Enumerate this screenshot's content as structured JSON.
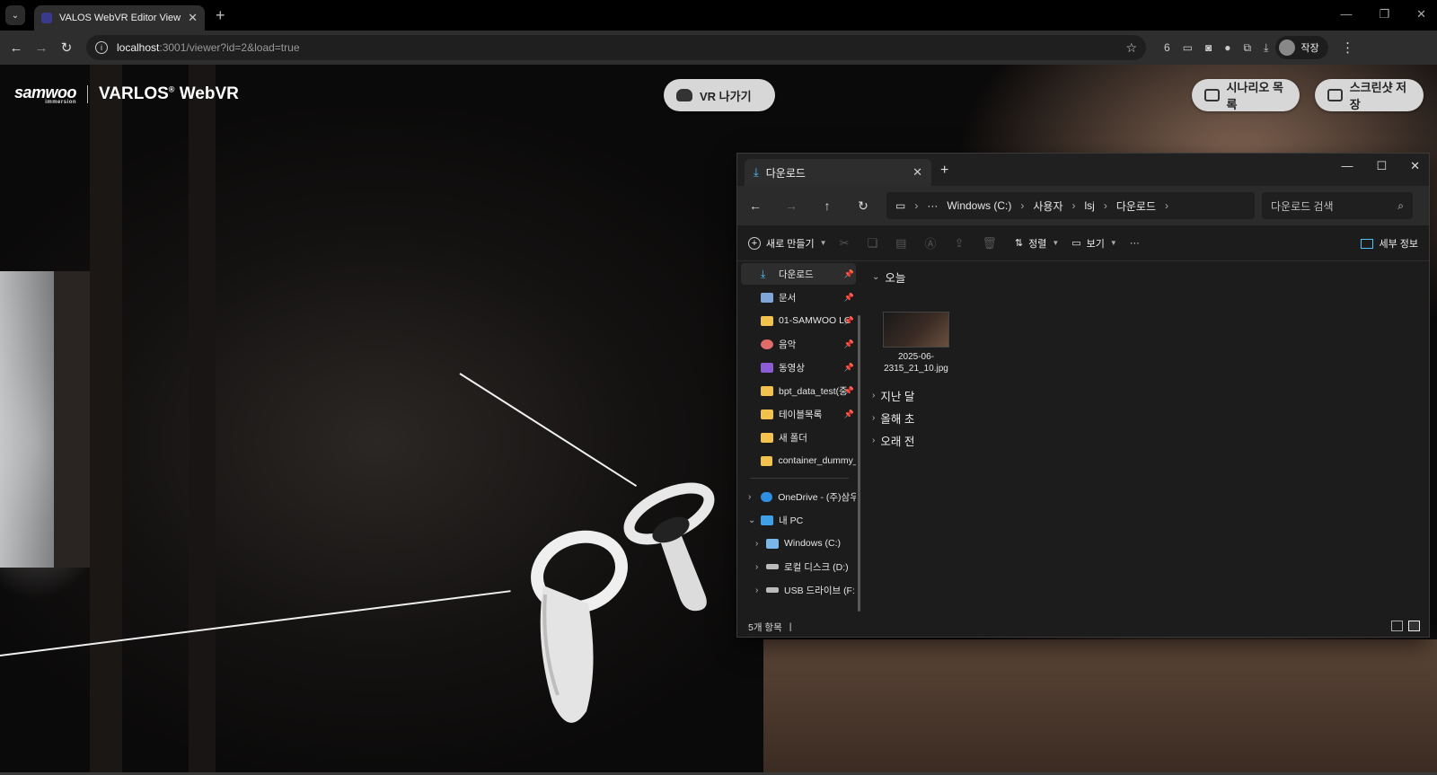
{
  "browser": {
    "tab_title": "VALOS WebVR Editor View",
    "tab_close": "✕",
    "new_tab": "+",
    "url_host": "localhost",
    "url_path": ":3001/viewer?id=2&load=true",
    "ext_count": "6",
    "profile_name": "작장",
    "win_min": "—",
    "win_restore": "❐",
    "win_close": "✕"
  },
  "viewer": {
    "logo_text": "samwoo",
    "logo_sub": "immersion",
    "product": "VARLOS",
    "product_suffix": "WebVR",
    "product_reg": "®",
    "vr_exit_label": "VR 나가기",
    "scenario_list_label": "시나리오 목록",
    "screenshot_label": "스크린샷 저장"
  },
  "explorer": {
    "tab_label": "다운로드",
    "tab_close": "✕",
    "new_tab": "+",
    "win_min": "—",
    "win_max": "☐",
    "win_close": "✕",
    "breadcrumbs": [
      "Windows (C:)",
      "사용자",
      "lsj",
      "다운로드"
    ],
    "crumb_more": "···",
    "search_placeholder": "다운로드 검색",
    "commands": {
      "new": "새로 만들기",
      "sort": "정렬",
      "view": "보기",
      "more": "···",
      "details": "세부 정보"
    },
    "sidebar": [
      {
        "label": "다운로드",
        "icon": "download-icon",
        "pinned": true,
        "selected": true
      },
      {
        "label": "문서",
        "icon": "document-icon",
        "pinned": true
      },
      {
        "label": "01-SAMWOO LO",
        "icon": "folder-icon",
        "pinned": true
      },
      {
        "label": "음악",
        "icon": "music-icon",
        "pinned": true
      },
      {
        "label": "동영상",
        "icon": "video-icon",
        "pinned": true
      },
      {
        "label": "bpt_data_test(중",
        "icon": "folder-icon",
        "pinned": true
      },
      {
        "label": "테이블목록",
        "icon": "folder-icon",
        "pinned": true
      },
      {
        "label": "새 폴더",
        "icon": "folder-icon"
      },
      {
        "label": "container_dummy_",
        "icon": "folder-icon"
      }
    ],
    "tree": [
      {
        "label": "OneDrive - (주)삼우",
        "icon": "onedrive-icon",
        "expander": "›"
      },
      {
        "label": "내 PC",
        "icon": "pc-icon",
        "expander": "⌄"
      },
      {
        "label": "Windows (C:)",
        "icon": "drive-icon",
        "expander": "›"
      },
      {
        "label": "로컬 디스크 (D:)",
        "icon": "drive-icon",
        "expander": "›"
      },
      {
        "label": "USB 드라이브 (F:)",
        "icon": "drive-icon",
        "expander": "›"
      }
    ],
    "groups": {
      "today": "오늘",
      "last_month": "지난 달",
      "earlier_this_year": "올해 초",
      "long_ago": "오래 전"
    },
    "file": {
      "name": "2025-06-2315_21_10.jpg"
    },
    "status": "5개 항목",
    "status_cursor": "|"
  },
  "colors": {
    "accent": "#4cc2ff",
    "pill_bg": "#d7d7d7"
  }
}
